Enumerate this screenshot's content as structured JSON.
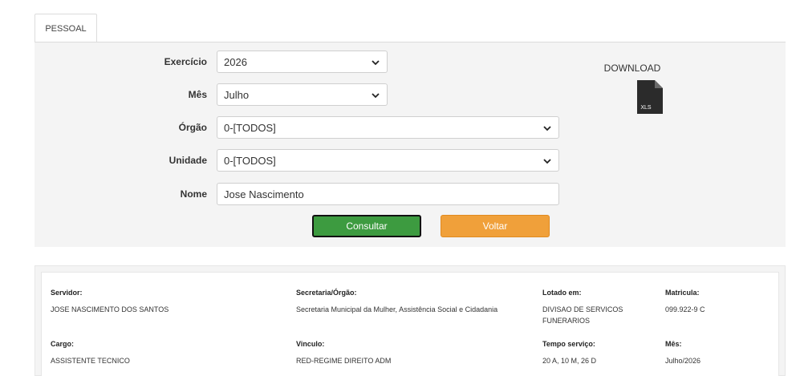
{
  "tabs": [
    {
      "label": "PESSOAL"
    }
  ],
  "form": {
    "exercicio": {
      "label": "Exercício",
      "value": "2026"
    },
    "mes": {
      "label": "Mês",
      "value": "Julho"
    },
    "orgao": {
      "label": "Órgão",
      "value": "0-[TODOS]"
    },
    "unidade": {
      "label": "Unidade",
      "value": "0-[TODOS]"
    },
    "nome": {
      "label": "Nome",
      "value": "Jose Nascimento"
    }
  },
  "buttons": {
    "consultar": "Consultar",
    "voltar": "Voltar"
  },
  "download": {
    "label": "DOWNLOAD",
    "icon": "xls-file-icon",
    "icon_text": "XLS"
  },
  "result": {
    "servidor": {
      "label": "Servidor:",
      "value": "JOSE NASCIMENTO DOS SANTOS"
    },
    "secretaria": {
      "label": "Secretaria/Órgão:",
      "value": "Secretaria Municipal da Mulher, Assistência Social e Cidadania"
    },
    "lotado": {
      "label": "Lotado em:",
      "value": "DIVISAO DE SERVICOS FUNERARIOS"
    },
    "matricula": {
      "label": "Matricula:",
      "value": "099.922-9 C"
    },
    "cargo": {
      "label": "Cargo:",
      "value": "ASSISTENTE TECNICO"
    },
    "vinculo": {
      "label": "Vinculo:",
      "value": "RED-REGIME DIREITO ADM"
    },
    "tempo": {
      "label": "Tempo serviço:",
      "value": "20 A, 10 M, 26 D"
    },
    "mes": {
      "label": "Mês:",
      "value": "Julho/2026"
    }
  },
  "colors": {
    "green": "#3d9b40",
    "orange": "#f0a03a",
    "panel": "#f4f4f4"
  }
}
